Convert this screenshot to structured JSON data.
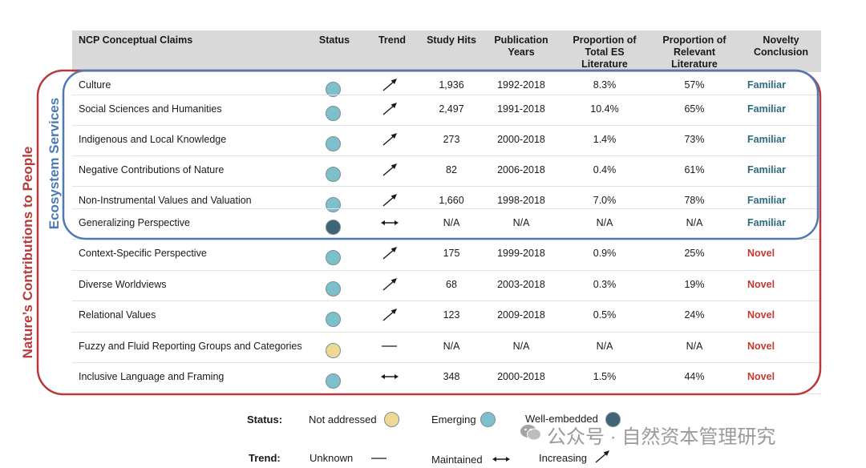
{
  "colors": {
    "not_addressed": "#efd892",
    "emerging": "#7dbfca",
    "well_embedded": "#3f6475",
    "familiar": "#2c6b7e",
    "novel": "#c23a30",
    "ncp_box": "#b8393b",
    "es_box": "#4e79b5",
    "header_bg": "#d9d9d9"
  },
  "chart_data": {
    "type": "table",
    "columns": [
      "NCP Conceptual Claims",
      "Status",
      "Trend",
      "Study Hits",
      "Publication Years",
      "Proportion of Total ES Literature",
      "Proportion of Relevant Literature",
      "Novelty Conclusion"
    ],
    "rows": [
      {
        "claim": "Culture",
        "status": "emerging",
        "trend": "increasing",
        "hits": "1,936",
        "years": "1992-2018",
        "total_es": "8.3%",
        "relevant": "57%",
        "conclusion": "Familiar"
      },
      {
        "claim": "Social Sciences and Humanities",
        "status": "emerging",
        "trend": "increasing",
        "hits": "2,497",
        "years": "1991-2018",
        "total_es": "10.4%",
        "relevant": "65%",
        "conclusion": "Familiar"
      },
      {
        "claim": "Indigenous and Local Knowledge",
        "status": "emerging",
        "trend": "increasing",
        "hits": "273",
        "years": "2000-2018",
        "total_es": "1.4%",
        "relevant": "73%",
        "conclusion": "Familiar"
      },
      {
        "claim": "Negative Contributions of Nature",
        "status": "emerging",
        "trend": "increasing",
        "hits": "82",
        "years": "2006-2018",
        "total_es": "0.4%",
        "relevant": "61%",
        "conclusion": "Familiar"
      },
      {
        "claim": "Non-Instrumental Values and Valuation",
        "status": "emerging",
        "trend": "increasing",
        "hits": "1,660",
        "years": "1998-2018",
        "total_es": "7.0%",
        "relevant": "78%",
        "conclusion": "Familiar"
      },
      {
        "claim": "Generalizing Perspective",
        "status": "well_embedded",
        "trend": "maintained",
        "hits": "N/A",
        "years": "N/A",
        "total_es": "N/A",
        "relevant": "N/A",
        "conclusion": "Familiar"
      },
      {
        "claim": "Context-Specific Perspective",
        "status": "emerging",
        "trend": "increasing",
        "hits": "175",
        "years": "1999-2018",
        "total_es": "0.9%",
        "relevant": "25%",
        "conclusion": "Novel"
      },
      {
        "claim": "Diverse Worldviews",
        "status": "emerging",
        "trend": "increasing",
        "hits": "68",
        "years": "2003-2018",
        "total_es": "0.3%",
        "relevant": "19%",
        "conclusion": "Novel"
      },
      {
        "claim": "Relational Values",
        "status": "emerging",
        "trend": "increasing",
        "hits": "123",
        "years": "2009-2018",
        "total_es": "0.5%",
        "relevant": "24%",
        "conclusion": "Novel"
      },
      {
        "claim": "Fuzzy and Fluid Reporting Groups and Categories",
        "status": "not_addressed",
        "trend": "unknown",
        "hits": "N/A",
        "years": "N/A",
        "total_es": "N/A",
        "relevant": "N/A",
        "conclusion": "Novel"
      },
      {
        "claim": "Inclusive Language and Framing",
        "status": "emerging",
        "trend": "maintained",
        "hits": "348",
        "years": "2000-2018",
        "total_es": "1.5%",
        "relevant": "44%",
        "conclusion": "Novel"
      }
    ]
  },
  "side_labels": {
    "ncp": "Nature’s Contributions to People",
    "es": "Ecosystem Services"
  },
  "legend": {
    "status_label": "Status:",
    "not_addressed": "Not addressed",
    "emerging": "Emerging",
    "well_embedded": "Well-embedded",
    "trend_label": "Trend:",
    "unknown": "Unknown",
    "maintained": "Maintained",
    "increasing": "Increasing"
  },
  "watermark": {
    "text": "公众号 · 自然资本管理研究"
  }
}
